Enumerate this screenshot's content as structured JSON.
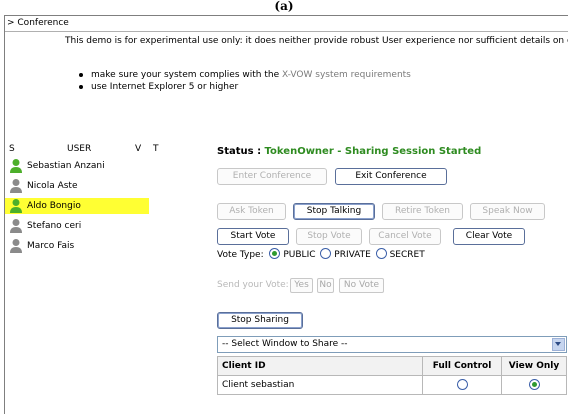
{
  "caption": "(a)",
  "header": {
    "title": "> Conference"
  },
  "notice": {
    "text": "This demo is for experimental use only: it does neither provide robust User experience nor sufficient details on c",
    "requirements": [
      {
        "before": "make sure your system complies with the ",
        "link": "X-VOW system requirements",
        "after": ""
      },
      {
        "before": "use Internet Explorer 5 or higher",
        "link": "",
        "after": ""
      }
    ]
  },
  "users": {
    "columns": {
      "s": "S",
      "user": "USER",
      "v": "V",
      "t": "T"
    },
    "items": [
      {
        "name": "Sebastian Anzani",
        "icon": "user-online-icon",
        "selected": false
      },
      {
        "name": "Nicola Aste",
        "icon": "user-offline-icon",
        "selected": false
      },
      {
        "name": "Aldo Bongio",
        "icon": "user-online-icon",
        "selected": true
      },
      {
        "name": "Stefano ceri",
        "icon": "user-offline-icon",
        "selected": false
      },
      {
        "name": "Marco Fais",
        "icon": "user-offline-icon",
        "selected": false
      }
    ]
  },
  "status": {
    "label": "Status : ",
    "value": "TokenOwner - Sharing Session Started"
  },
  "conference_buttons": {
    "enter": "Enter Conference",
    "exit": "Exit Conference"
  },
  "token_buttons": {
    "ask": "Ask Token",
    "stop_talking": "Stop Talking",
    "retire": "Retire Token",
    "speak": "Speak Now"
  },
  "vote_buttons": {
    "start": "Start Vote",
    "stop": "Stop Vote",
    "cancel": "Cancel Vote",
    "clear": "Clear Vote"
  },
  "vote_type": {
    "label": "Vote Type:",
    "options": [
      "PUBLIC",
      "PRIVATE",
      "SECRET"
    ],
    "selected": "PUBLIC"
  },
  "send_vote": {
    "label": "Send your Vote:",
    "yes": "Yes",
    "no": "No",
    "no_vote": "No Vote"
  },
  "sharing": {
    "stop": "Stop Sharing",
    "select_placeholder": "-- Select Window to Share --"
  },
  "clients_table": {
    "headers": {
      "client": "Client ID",
      "full": "Full Control",
      "view": "View Only"
    },
    "rows": [
      {
        "client": "Client sebastian",
        "mode": "view"
      }
    ]
  },
  "colors": {
    "status_green": "#2e8b20",
    "selected_row": "#ffff33",
    "online_user": "#4caf2a",
    "offline_user": "#8a8a8a"
  }
}
